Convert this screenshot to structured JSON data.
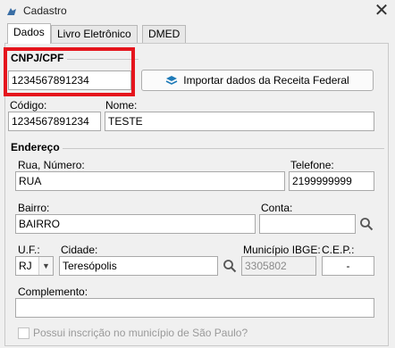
{
  "window": {
    "title": "Cadastro",
    "close_glyph": "✕"
  },
  "tabs": [
    {
      "label": "Dados"
    },
    {
      "label": "Livro Eletrônico"
    },
    {
      "label": "DMED"
    }
  ],
  "cnpj": {
    "label": "CNPJ/CPF",
    "value": "1234567891234"
  },
  "import_button": {
    "label": "Importar dados da Receita Federal",
    "icon": "import-download-icon"
  },
  "codigo": {
    "label": "Código:",
    "value": "1234567891234"
  },
  "nome": {
    "label": "Nome:",
    "value": "TESTE"
  },
  "endereco": {
    "section_label": "Endereço"
  },
  "rua": {
    "label": "Rua, Número:",
    "value": "RUA"
  },
  "telefone": {
    "label": "Telefone:",
    "value": "2199999999"
  },
  "bairro": {
    "label": "Bairro:",
    "value": "BAIRRO"
  },
  "conta": {
    "label": "Conta:",
    "value": ""
  },
  "uf": {
    "label": "U.F.:",
    "value": "RJ"
  },
  "cidade": {
    "label": "Cidade:",
    "value": "Teresópolis"
  },
  "municipio_ibge": {
    "label": "Município IBGE:",
    "value": "3305802"
  },
  "cep": {
    "label": "C.E.P.:",
    "value": "-"
  },
  "complemento": {
    "label": "Complemento:",
    "value": ""
  },
  "inscricao": {
    "label": "Possui inscrição no município de São Paulo?",
    "checked": false
  },
  "colors": {
    "highlight": "#e5151d",
    "accent": "#1e7ab8"
  }
}
